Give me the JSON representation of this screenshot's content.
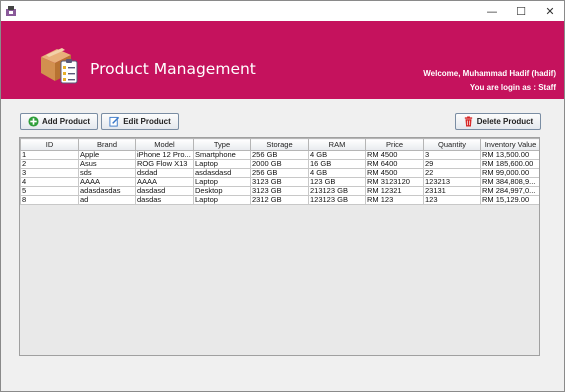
{
  "window": {
    "minimize": "—",
    "maximize": "☐",
    "close": "✕"
  },
  "banner": {
    "title": "Product Management",
    "welcome": "Welcome, Muhammad Hadif (hadif)",
    "login_as": "You are login as : Staff"
  },
  "toolbar": {
    "add_label": "Add Product",
    "edit_label": "Edit Product",
    "delete_label": "Delete Product"
  },
  "table": {
    "columns": [
      "ID",
      "Brand",
      "Model",
      "Type",
      "Storage",
      "RAM",
      "Price",
      "Quantity",
      "Inventory Value"
    ],
    "rows": [
      [
        "1",
        "Apple",
        "iPhone 12 Pro...",
        "Smartphone",
        "256 GB",
        "4 GB",
        "RM 4500",
        "3",
        "RM 13,500.00"
      ],
      [
        "2",
        "Asus",
        "ROG Flow X13",
        "Laptop",
        "2000 GB",
        "16 GB",
        "RM 6400",
        "29",
        "RM 185,600.00"
      ],
      [
        "3",
        "sds",
        "dsdad",
        "asdasdasd",
        "256 GB",
        "4 GB",
        "RM 4500",
        "22",
        "RM 99,000.00"
      ],
      [
        "4",
        "AAAA",
        "AAAA",
        "Laptop",
        "3123 GB",
        "123 GB",
        "RM 3123120",
        "123213",
        "RM 384,808,9..."
      ],
      [
        "5",
        "adasdasdas",
        "dasdasd",
        "Desktop",
        "3123 GB",
        "213123 GB",
        "RM 12321",
        "23131",
        "RM 284,997,0..."
      ],
      [
        "8",
        "ad",
        "dasdas",
        "Laptop",
        "2312 GB",
        "123123 GB",
        "RM 123",
        "123",
        "RM 15,129.00"
      ]
    ]
  },
  "colors": {
    "banner": "#c5125d",
    "add_icon": "#2e9e3a",
    "delete_icon": "#d62020"
  },
  "icons": {
    "app": "app-icon",
    "logo": "box-checklist-icon",
    "add": "plus-circle-icon",
    "edit": "edit-document-icon",
    "delete": "trash-icon"
  }
}
